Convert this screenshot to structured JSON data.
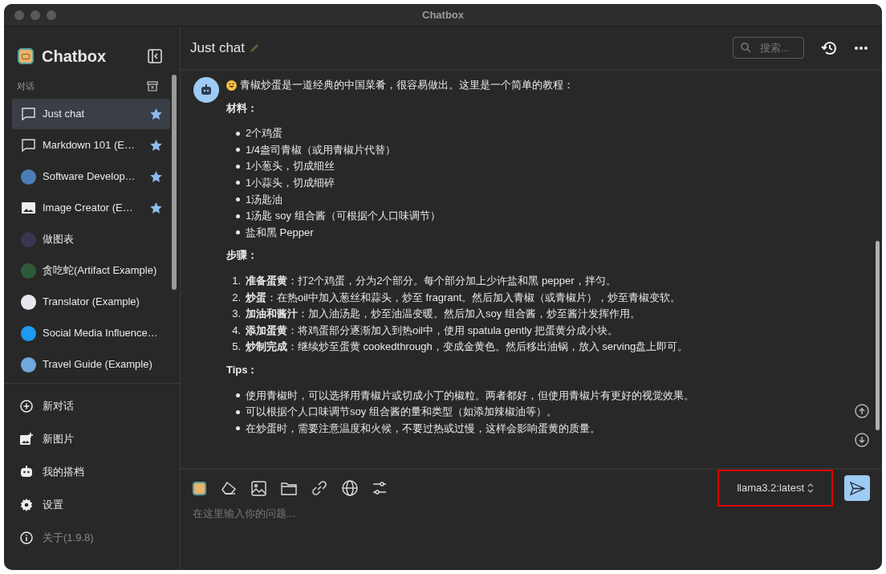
{
  "window": {
    "title": "Chatbox"
  },
  "sidebar": {
    "app_name": "Chatbox",
    "section_label": "对话",
    "conversations": [
      {
        "label": "Just chat",
        "kind": "chat",
        "starred": true,
        "selected": true
      },
      {
        "label": "Markdown 101 (E…",
        "kind": "chat",
        "starred": true,
        "selected": false
      },
      {
        "label": "Software Develop…",
        "kind": "avatar",
        "color": "#4a7db5",
        "starred": true,
        "selected": false
      },
      {
        "label": "Image Creator (E…",
        "kind": "image",
        "starred": true,
        "selected": false
      },
      {
        "label": "做图表",
        "kind": "avatar",
        "color": "#3a3550",
        "starred": false,
        "selected": false
      },
      {
        "label": "贪吃蛇(Artifact Example)",
        "kind": "avatar",
        "color": "#2f5a3a",
        "starred": false,
        "selected": false
      },
      {
        "label": "Translator (Example)",
        "kind": "avatar",
        "color": "#e8e8f0",
        "starred": false,
        "selected": false
      },
      {
        "label": "Social Media Influence…",
        "kind": "avatar",
        "color": "#1d9bf0",
        "starred": false,
        "selected": false
      },
      {
        "label": "Travel Guide (Example)",
        "kind": "avatar",
        "color": "#6fa8dc",
        "starred": false,
        "selected": false
      }
    ],
    "menu": [
      {
        "label": "新对话",
        "kind": "new-chat"
      },
      {
        "label": "新图片",
        "kind": "new-image"
      },
      {
        "label": "我的搭档",
        "kind": "copilots"
      },
      {
        "label": "设置",
        "kind": "settings"
      },
      {
        "label": "关于(1.9.8)",
        "kind": "about"
      }
    ]
  },
  "chat": {
    "title": "Just chat",
    "search": {
      "placeholder": "搜索..."
    },
    "message": {
      "intro": "青椒炒蛋是一道经典的中国菜肴，很容易做出。这里是一个简单的教程：",
      "sections": [
        {
          "heading": "材料：",
          "kind": "bullets",
          "items": [
            {
              "text": "2个鸡蛋"
            },
            {
              "text": "1/4盎司青椒（或用青椒片代替）"
            },
            {
              "text": "1小葱头，切成细丝"
            },
            {
              "text": "1小蒜头，切成细碎"
            },
            {
              "text": "1汤匙油"
            },
            {
              "text": "1汤匙 soy 组合酱（可根据个人口味调节）"
            },
            {
              "text": "盐和黑 Pepper"
            }
          ]
        },
        {
          "heading": "步骤：",
          "kind": "numbered",
          "items": [
            {
              "number": "1.",
              "text": "**准备蛋黄**：打2个鸡蛋，分为2个部分。每个部分加上少许盐和黑 pepper，拌匀。"
            },
            {
              "number": "2.",
              "text": "**炒蛋**：在热oil中加入葱丝和蒜头，炒至 fragrant。然后加入青椒（或青椒片），炒至青椒变软。"
            },
            {
              "number": "3.",
              "text": "**加油和酱汁**：加入油汤匙，炒至油温变暖。然后加入soy 组合酱，炒至酱汁发挥作用。"
            },
            {
              "number": "4.",
              "text": "**添加蛋黄**：将鸡蛋部分逐渐加入到热oil中，使用 spatula gently 把蛋黄分成小块。"
            },
            {
              "number": "5.",
              "text": "**炒制完成**：继续炒至蛋黄 cookedthrough，变成金黄色。然后移出油锅，放入 serving盘上即可。"
            }
          ]
        },
        {
          "heading": "Tips：",
          "kind": "bullets",
          "items": [
            {
              "text": "使用青椒时，可以选择用青椒片或切成小丁的椒粒。两者都好，但使用青椒片有更好的视觉效果。"
            },
            {
              "text": "可以根据个人口味调节soy 组合酱的量和类型（如添加辣椒油等）。"
            },
            {
              "text": "在炒蛋时，需要注意温度和火候，不要过热或过慢，这样会影响蛋黄的质量。"
            }
          ]
        }
      ]
    },
    "composer": {
      "model": "llama3.2:latest",
      "model_highlighted": true,
      "placeholder": "在这里输入你的问题..."
    }
  }
}
